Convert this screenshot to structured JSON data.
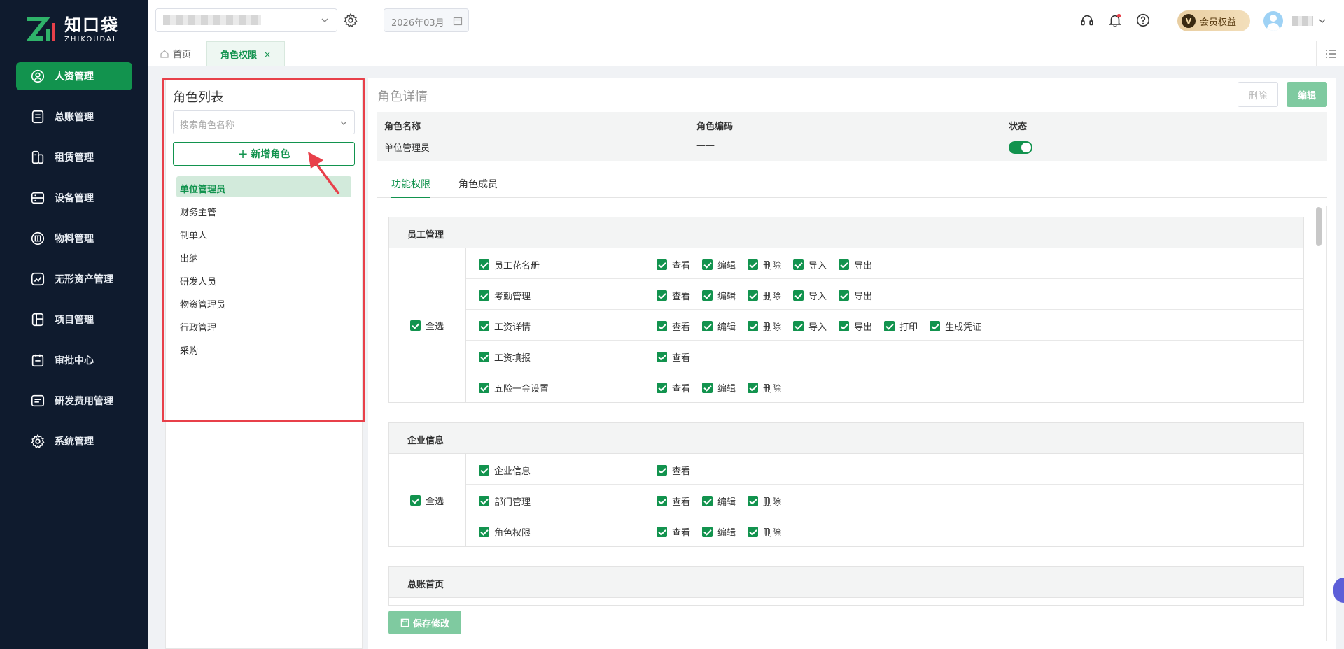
{
  "brand": {
    "name_cn": "知口袋",
    "name_en": "ZHIKOUDAI"
  },
  "sidebar": {
    "items": [
      {
        "label": "人资管理",
        "icon": "user-circle-icon",
        "active": true
      },
      {
        "label": "总账管理",
        "icon": "ledger-icon"
      },
      {
        "label": "租赁管理",
        "icon": "lease-icon"
      },
      {
        "label": "设备管理",
        "icon": "device-icon"
      },
      {
        "label": "物料管理",
        "icon": "material-icon"
      },
      {
        "label": "无形资产管理",
        "icon": "intangible-asset-icon"
      },
      {
        "label": "项目管理",
        "icon": "project-icon"
      },
      {
        "label": "审批中心",
        "icon": "approval-icon"
      },
      {
        "label": "研发费用管理",
        "icon": "rd-expense-icon"
      },
      {
        "label": "系统管理",
        "icon": "settings-icon"
      }
    ]
  },
  "header": {
    "period": "2026年03月",
    "vip_badge": "V",
    "vip_label": "会员权益"
  },
  "tabs": {
    "home": "首页",
    "current": "角色权限",
    "close": "×"
  },
  "role_list": {
    "title": "角色列表",
    "search_placeholder": "搜索角色名称",
    "add_label": "新增角色",
    "roles": [
      "单位管理员",
      "财务主管",
      "制单人",
      "出纳",
      "研发人员",
      "物资管理员",
      "行政管理",
      "采购"
    ],
    "selected_index": 0
  },
  "detail": {
    "title": "角色详情",
    "delete_label": "删除",
    "edit_label": "编辑",
    "name_label": "角色名称",
    "name_value": "单位管理员",
    "code_label": "角色编码",
    "code_value": "——",
    "status_label": "状态",
    "status_on": true,
    "subtabs": [
      "功能权限",
      "角色成员"
    ],
    "active_subtab": 0,
    "select_all_label": "全选",
    "save_label": "保存修改"
  },
  "permission_groups": [
    {
      "title": "员工管理",
      "rows": [
        {
          "name": "员工花名册",
          "actions": [
            "查看",
            "编辑",
            "删除",
            "导入",
            "导出"
          ]
        },
        {
          "name": "考勤管理",
          "actions": [
            "查看",
            "编辑",
            "删除",
            "导入",
            "导出"
          ]
        },
        {
          "name": "工资详情",
          "actions": [
            "查看",
            "编辑",
            "删除",
            "导入",
            "导出",
            "打印",
            "生成凭证"
          ]
        },
        {
          "name": "工资填报",
          "actions": [
            "查看"
          ]
        },
        {
          "name": "五险一金设置",
          "actions": [
            "查看",
            "编辑",
            "删除"
          ]
        }
      ]
    },
    {
      "title": "企业信息",
      "rows": [
        {
          "name": "企业信息",
          "actions": [
            "查看"
          ]
        },
        {
          "name": "部门管理",
          "actions": [
            "查看",
            "编辑",
            "删除"
          ]
        },
        {
          "name": "角色权限",
          "actions": [
            "查看",
            "编辑",
            "删除"
          ]
        }
      ]
    },
    {
      "title": "总账首页",
      "rows": []
    }
  ],
  "colors": {
    "sidebar_bg": "#0f1b2e",
    "accent": "#12934e",
    "highlight_border": "#e8404a"
  }
}
